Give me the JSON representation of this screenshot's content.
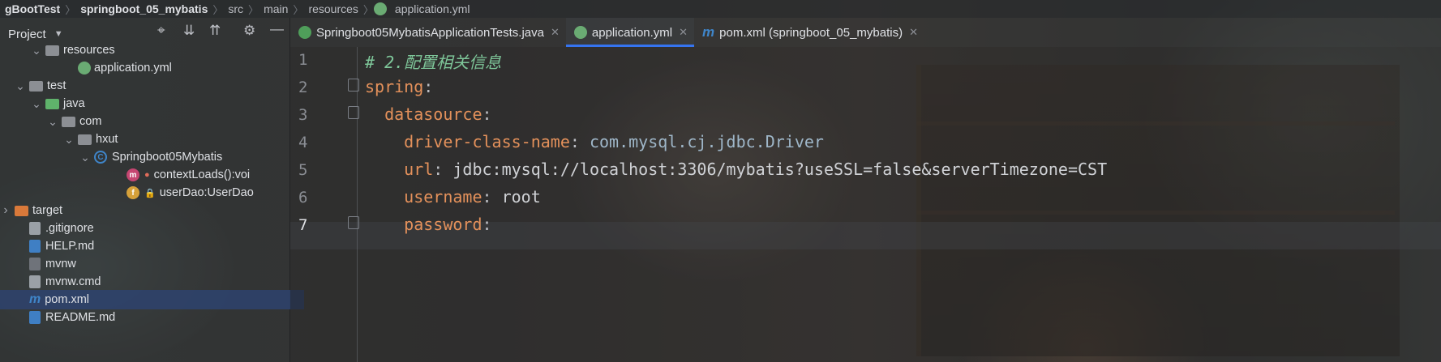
{
  "breadcrumb": [
    "gBootTest",
    "springboot_05_mybatis",
    "src",
    "main",
    "resources",
    "application.yml"
  ],
  "project_panel": {
    "title": "Project",
    "icons": [
      "target-icon",
      "expand-all-icon",
      "collapse-all-icon",
      "gear-icon",
      "minimize-icon"
    ]
  },
  "tree": [
    {
      "label": "resources",
      "indent": 3,
      "arrow": "down",
      "icon": "resources-folder"
    },
    {
      "label": "application.yml",
      "indent": 5,
      "arrow": "",
      "icon": "yml"
    },
    {
      "label": "test",
      "indent": 2,
      "arrow": "down",
      "icon": "gray-folder"
    },
    {
      "label": "java",
      "indent": 3,
      "arrow": "down",
      "icon": "green-folder"
    },
    {
      "label": "com",
      "indent": 4,
      "arrow": "down",
      "icon": "package"
    },
    {
      "label": "hxut",
      "indent": 5,
      "arrow": "down",
      "icon": "package"
    },
    {
      "label": "Springboot05Mybatis",
      "indent": 6,
      "arrow": "down",
      "icon": "class"
    },
    {
      "label": "contextLoads():voi",
      "indent": 8,
      "arrow": "",
      "icon": "method"
    },
    {
      "label": "userDao:UserDao",
      "indent": 8,
      "arrow": "",
      "icon": "field"
    },
    {
      "label": "target",
      "indent": 1,
      "arrow": "right",
      "icon": "orange-folder"
    },
    {
      "label": ".gitignore",
      "indent": 2,
      "arrow": "",
      "icon": "doc"
    },
    {
      "label": "HELP.md",
      "indent": 2,
      "arrow": "",
      "icon": "md"
    },
    {
      "label": "mvnw",
      "indent": 2,
      "arrow": "",
      "icon": "terminal"
    },
    {
      "label": "mvnw.cmd",
      "indent": 2,
      "arrow": "",
      "icon": "doc"
    },
    {
      "label": "pom.xml",
      "indent": 2,
      "arrow": "",
      "icon": "maven",
      "selected": true
    },
    {
      "label": "README.md",
      "indent": 2,
      "arrow": "",
      "icon": "md"
    }
  ],
  "tabs": [
    {
      "label": "Springboot05MybatisApplicationTests.java",
      "icon": "java",
      "active": false
    },
    {
      "label": "application.yml",
      "icon": "yml",
      "active": true
    },
    {
      "label": "pom.xml (springboot_05_mybatis)",
      "icon": "maven",
      "active": false
    }
  ],
  "editor": {
    "current_line": 7,
    "lines": [
      {
        "no": "1",
        "tokens": [
          {
            "t": "# 2.配置相关信息",
            "c": "c-comment"
          }
        ]
      },
      {
        "no": "2",
        "tokens": [
          {
            "t": "spring",
            "c": "c-key"
          },
          {
            "t": ":",
            "c": "c-punc"
          }
        ]
      },
      {
        "no": "3",
        "tokens": [
          {
            "t": "  datasource",
            "c": "c-key"
          },
          {
            "t": ":",
            "c": "c-punc"
          }
        ]
      },
      {
        "no": "4",
        "tokens": [
          {
            "t": "    driver-class-name",
            "c": "c-key"
          },
          {
            "t": ": ",
            "c": "c-punc"
          },
          {
            "t": "com.mysql.cj.jdbc.Driver",
            "c": "c-val"
          }
        ]
      },
      {
        "no": "5",
        "tokens": [
          {
            "t": "    url",
            "c": "c-key"
          },
          {
            "t": ": ",
            "c": "c-punc"
          },
          {
            "t": "jdbc:mysql://localhost:3306/mybatis?useSSL=false&serverTimezone=CST",
            "c": "c-plain"
          }
        ]
      },
      {
        "no": "6",
        "tokens": [
          {
            "t": "    username",
            "c": "c-key"
          },
          {
            "t": ": ",
            "c": "c-punc"
          },
          {
            "t": "root",
            "c": "c-plain"
          }
        ]
      },
      {
        "no": "7",
        "tokens": [
          {
            "t": "    password",
            "c": "c-key"
          },
          {
            "t": ":",
            "c": "c-punc"
          }
        ]
      }
    ]
  },
  "colors": {
    "accent": "#3574f0",
    "yaml_key": "#e4915b",
    "comment": "#7ec699"
  }
}
